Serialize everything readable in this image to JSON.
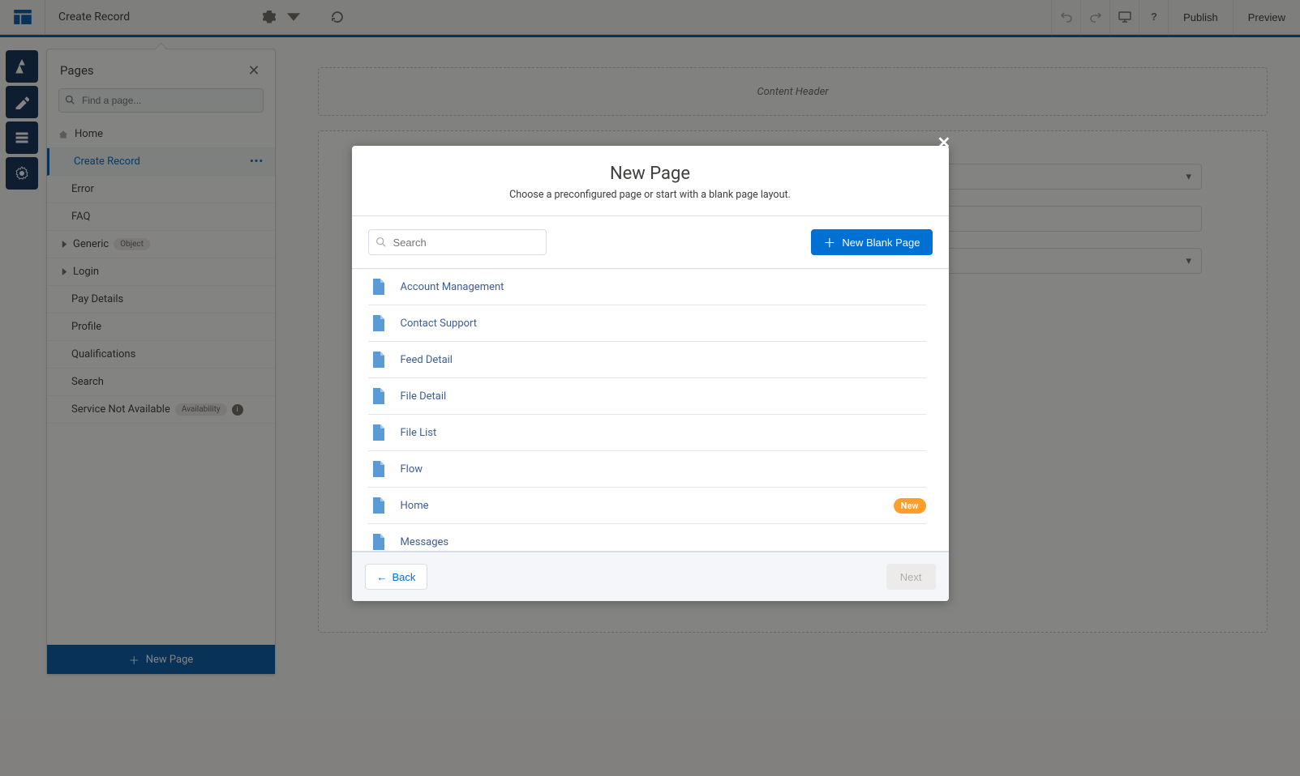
{
  "topbar": {
    "page_label": "Create Record",
    "publish_label": "Publish",
    "preview_label": "Preview"
  },
  "pages_panel": {
    "title": "Pages",
    "find_placeholder": "Find a page...",
    "items": [
      {
        "label": "Home",
        "kind": "home"
      },
      {
        "label": "Create Record",
        "kind": "active"
      },
      {
        "label": "Error"
      },
      {
        "label": "FAQ"
      },
      {
        "label": "Generic",
        "kind": "folder",
        "badge": "Object"
      },
      {
        "label": "Login",
        "kind": "folder"
      },
      {
        "label": "Pay Details"
      },
      {
        "label": "Profile"
      },
      {
        "label": "Qualifications"
      },
      {
        "label": "Search"
      },
      {
        "label": "Service Not Available",
        "badge": "Availability",
        "info": true
      }
    ],
    "new_page_label": "New Page"
  },
  "canvas": {
    "header_placeholder": "Content Header"
  },
  "modal": {
    "title": "New Page",
    "subtitle": "Choose a preconfigured page or start with a blank page layout.",
    "search_placeholder": "Search",
    "new_blank_label": "New Blank Page",
    "templates": [
      {
        "name": "Account Management"
      },
      {
        "name": "Contact Support"
      },
      {
        "name": "Feed Detail"
      },
      {
        "name": "File Detail"
      },
      {
        "name": "File List"
      },
      {
        "name": "Flow"
      },
      {
        "name": "Home",
        "badge": "New"
      },
      {
        "name": "Messages"
      }
    ],
    "back_label": "Back",
    "next_label": "Next"
  }
}
